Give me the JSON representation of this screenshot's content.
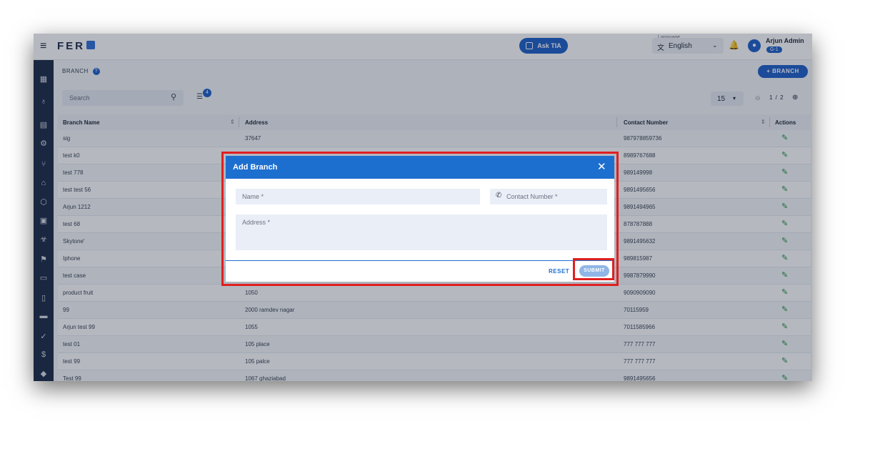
{
  "app": {
    "brand": "FER"
  },
  "topbar": {
    "ask_tia": "Ask TIA",
    "language_label": "Language",
    "language_value": "English",
    "user_name": "Arjun Admin",
    "user_badge": "G-1"
  },
  "page": {
    "breadcrumb": "BRANCH",
    "add_button": "+ BRANCH",
    "search_placeholder": "Search",
    "filter_count": "4",
    "per_page": "15",
    "pagination": "1 / 2"
  },
  "table": {
    "headers": {
      "name": "Branch Name",
      "address": "Address",
      "contact": "Contact Number",
      "actions": "Actions"
    },
    "rows": [
      {
        "name": "sig",
        "address": "37647",
        "contact": "987978859736"
      },
      {
        "name": "test k0",
        "address": "",
        "contact": "8989767688"
      },
      {
        "name": "test 778",
        "address": "",
        "contact": "989149998"
      },
      {
        "name": "test test 56",
        "address": "",
        "contact": "9891495656"
      },
      {
        "name": "Arjun 1212",
        "address": "",
        "contact": "9891494965"
      },
      {
        "name": "test 68",
        "address": "",
        "contact": "878787888"
      },
      {
        "name": "Skytone'",
        "address": "",
        "contact": "9891495632"
      },
      {
        "name": "Iphone",
        "address": "",
        "contact": "989815987"
      },
      {
        "name": "test case",
        "address": "",
        "contact": "9987879990"
      },
      {
        "name": "product fruit",
        "address": "1050",
        "contact": "9090909090"
      },
      {
        "name": "99",
        "address": "2000 ramdev nagar",
        "contact": "70115959"
      },
      {
        "name": "Arjun test 99",
        "address": "1055",
        "contact": "7011585966"
      },
      {
        "name": "test 01",
        "address": "105 place",
        "contact": "777 777 777"
      },
      {
        "name": "test 99",
        "address": "105 palce",
        "contact": "777 777 777"
      },
      {
        "name": "Test 99",
        "address": "1067 ghaziabad",
        "contact": "9891495656"
      }
    ]
  },
  "modal": {
    "title": "Add Branch",
    "name_placeholder": "Name *",
    "contact_placeholder": "Contact Number *",
    "address_placeholder": "Address *",
    "reset_label": "RESET",
    "submit_label": "SUBMIT"
  },
  "colors": {
    "primary": "#1d5fc7",
    "sidebar": "#1b2a44",
    "highlight": "#e02020",
    "edit": "#1e8e3e"
  }
}
